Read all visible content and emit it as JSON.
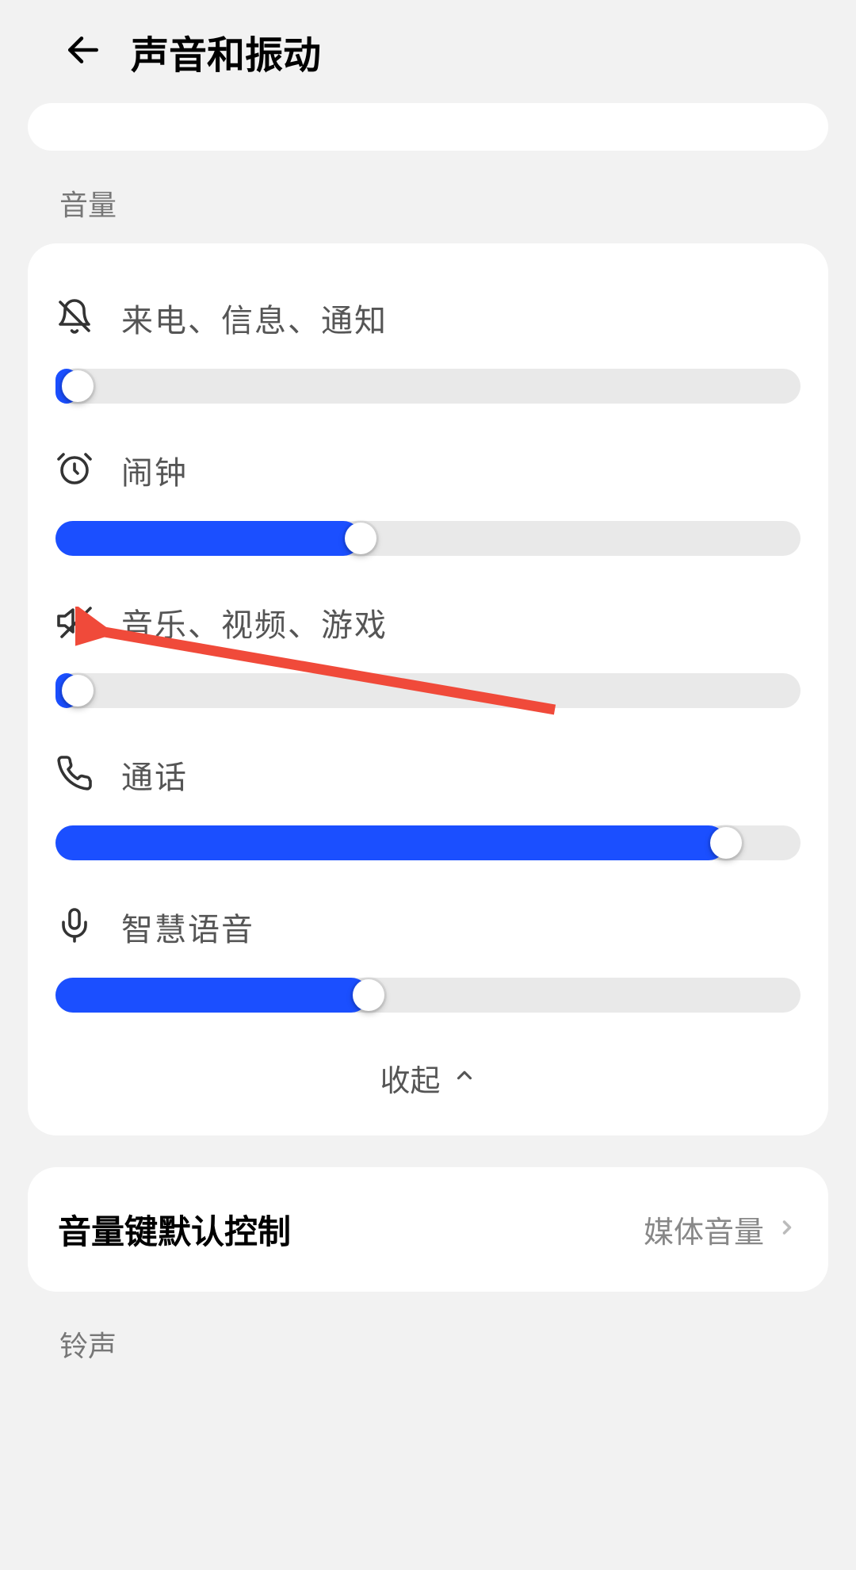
{
  "header": {
    "title": "声音和振动"
  },
  "sections": {
    "volume_label": "音量",
    "ringtone_label": "铃声"
  },
  "sliders": {
    "ringtone": {
      "label": "来电、信息、通知",
      "value": 0
    },
    "alarm": {
      "label": "闹钟",
      "value": 41
    },
    "media": {
      "label": "音乐、视频、游戏",
      "value": 0
    },
    "call": {
      "label": "通话",
      "value": 90
    },
    "voice": {
      "label": "智慧语音",
      "value": 42
    }
  },
  "collapse": {
    "label": "收起"
  },
  "volume_key": {
    "label": "音量键默认控制",
    "value": "媒体音量"
  },
  "colors": {
    "accent": "#1b4fff",
    "arrow": "#f04a3a"
  }
}
